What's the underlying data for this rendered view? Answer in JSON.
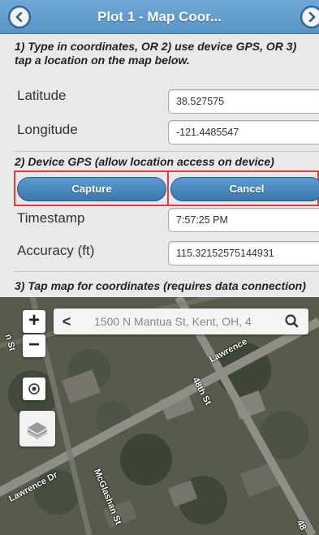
{
  "header": {
    "title": "Plot 1 - Map Coor...",
    "back_icon": "chevron-left-icon",
    "forward_icon": "chevron-right-icon",
    "color": "#5f9acb"
  },
  "instructions": "1) Type in coordinates, OR 2) use device GPS, OR 3) tap a location on the map below.",
  "coordinates": {
    "latitude_label": "Latitude",
    "latitude_value": "38.527575",
    "longitude_label": "Longitude",
    "longitude_value": "-121.4485547"
  },
  "gps": {
    "heading": "2) Device GPS (allow location access on device)",
    "capture_label": "Capture",
    "cancel_label": "Cancel",
    "timestamp_label": "Timestamp",
    "timestamp_value": "7:57:25 PM",
    "accuracy_label": "Accuracy (ft)",
    "accuracy_value": "115.32152575144931"
  },
  "map_section": {
    "heading": "3) Tap map for coordinates (requires data connection)",
    "zoom_in": "+",
    "zoom_out": "−",
    "search_back": "<",
    "search_text": "1500 N Mantua St, Kent, OH, 4",
    "search_icon": "search-icon",
    "locate_icon": "target-icon",
    "layers_icon": "layers-icon",
    "roads": [
      "Lawrence",
      "48th St",
      "Lawrence Dr",
      "McGlashan St",
      "48",
      "n St"
    ]
  }
}
